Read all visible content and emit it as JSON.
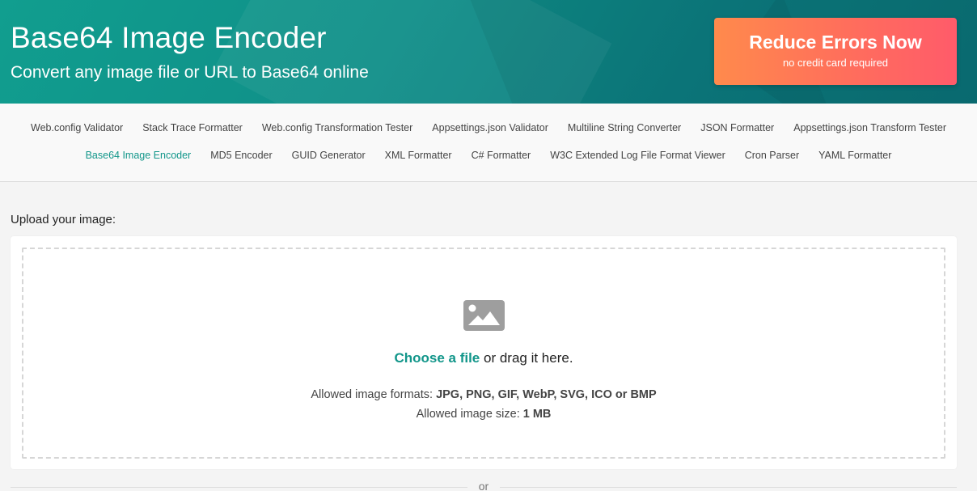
{
  "header": {
    "title": "Base64 Image Encoder",
    "subtitle": "Convert any image file or URL to Base64 online",
    "cta": {
      "title": "Reduce Errors Now",
      "subtitle": "no credit card required"
    },
    "colors": {
      "brand": "#119e8f",
      "cta_start": "#ff8a4c",
      "cta_end": "#ff5b6a"
    }
  },
  "nav": {
    "row1": [
      "Web.config Validator",
      "Stack Trace Formatter",
      "Web.config Transformation Tester",
      "Appsettings.json Validator",
      "Multiline String Converter",
      "JSON Formatter",
      "Appsettings.json Transform Tester"
    ],
    "row2": [
      "Base64 Image Encoder",
      "MD5 Encoder",
      "GUID Generator",
      "XML Formatter",
      "C# Formatter",
      "W3C Extended Log File Format Viewer",
      "Cron Parser",
      "YAML Formatter"
    ],
    "active": "Base64 Image Encoder",
    "active_color": "#12968a"
  },
  "upload": {
    "label": "Upload your image:",
    "icon": "image-icon",
    "choose_link": "Choose a file",
    "choose_rest": " or drag it here.",
    "formats_prefix": "Allowed image formats: ",
    "formats_value": "JPG, PNG, GIF, WebP, SVG, ICO or BMP",
    "size_prefix": "Allowed image size: ",
    "size_value": "1 MB"
  },
  "divider": {
    "text": "or"
  }
}
